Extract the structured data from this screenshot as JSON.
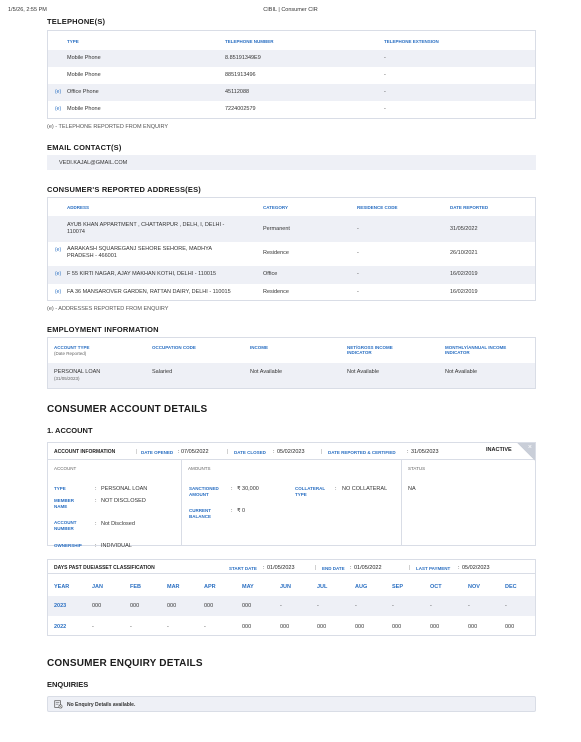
{
  "print_header": {
    "datetime": "1/5/26, 2:55 PM",
    "title": "CIBIL | Consumer CIR"
  },
  "telephones": {
    "title": "TELEPHONE(S)",
    "headers": [
      "TYPE",
      "TELEPHONE NUMBER",
      "TELEPHONE EXTENSION"
    ],
    "rows": [
      {
        "marker": "",
        "type": "Mobile Phone",
        "number": "8.85191349E9",
        "ext": "-"
      },
      {
        "marker": "",
        "type": "Mobile Phone",
        "number": "8851913496",
        "ext": "-"
      },
      {
        "marker": "(e)",
        "type": "Office Phone",
        "number": "45112088",
        "ext": "-"
      },
      {
        "marker": "(e)",
        "type": "Mobile Phone",
        "number": "7224002579",
        "ext": "-"
      }
    ],
    "footnote": "(e) - TELEPHONE REPORTED FROM ENQUIRY"
  },
  "emails": {
    "title": "EMAIL CONTACT(S)",
    "value": "VEDI.KAJAL@GMAIL.COM"
  },
  "addresses": {
    "title": "CONSUMER'S REPORTED ADDRESS(ES)",
    "headers": [
      "ADDRESS",
      "CATEGORY",
      "RESIDENCE CODE",
      "DATE REPORTED"
    ],
    "rows": [
      {
        "marker": "",
        "line1": "AYUB KHAN APPARTMENT , CHATTARPUR , DELH, I, DELHI -",
        "line2": "110074",
        "category": "Permanent",
        "code": "-",
        "date": "31/05/2022"
      },
      {
        "marker": "(e)",
        "line1": "AARAKASH SQUAREGANJ SEHORE SEHORE, MADHYA",
        "line2": "PRADESH - 466001",
        "category": "Residence",
        "code": "-",
        "date": "26/10/2021"
      },
      {
        "marker": "(e)",
        "line1": "F 55 KIRTI NAGAR, AJAY MAKHAN KOTHI, DELHI - 110015",
        "line2": "",
        "category": "Office",
        "code": "-",
        "date": "16/02/2019"
      },
      {
        "marker": "(e)",
        "line1": "FA 36 MANSAROVER GARDEN, RATTAN DAIRY, DELHI - 110015",
        "line2": "",
        "category": "Residence",
        "code": "-",
        "date": "16/02/2019"
      }
    ],
    "footnote": "(e) - ADDRESSES REPORTED FROM ENQUIRY"
  },
  "employment": {
    "title": "EMPLOYMENT INFORMATION",
    "headers": {
      "account_type": "ACCOUNT TYPE",
      "account_type_sub": "(Date Reported)",
      "occupation": "OCCUPATION CODE",
      "income": "INCOME",
      "net_gross_1": "NET/GROSS INCOME",
      "net_gross_2": "INDICATOR",
      "monthly_annual_1": "MONTHLY/ANNUAL INCOME",
      "monthly_annual_2": "INDICATOR"
    },
    "row": {
      "account_type": "PERSONAL LOAN",
      "date": "(31/05/2023)",
      "occupation": "Salaried",
      "income": "Not Available",
      "net_gross": "Not Available",
      "monthly_annual": "Not Available"
    }
  },
  "account_details": {
    "title": "CONSUMER ACCOUNT DETAILS",
    "subtitle": "1. ACCOUNT",
    "header": {
      "label": "ACCOUNT INFORMATION",
      "date_opened_label": "DATE OPENED",
      "date_opened": "07/05/2022",
      "date_closed_label": "DATE CLOSED",
      "date_closed": "05/02/2023",
      "date_reported_label": "DATE REPORTED & CERTIFIED",
      "date_reported": "31/05/2023",
      "status_badge": "INACTIVE",
      "close_glyph": "×"
    },
    "account": {
      "heading": "ACCOUNT",
      "type_label": "TYPE",
      "type": "PERSONAL LOAN",
      "member_label_1": "MEMBER",
      "member_label_2": "NAME",
      "member": "NOT DISCLOSED",
      "number_label_1": "ACCOUNT",
      "number_label_2": "NUMBER",
      "number": "Not Disclosed",
      "ownership_label": "OWNERSHIP",
      "ownership": "INDIVIDUAL"
    },
    "amounts": {
      "heading": "AMOUNTS",
      "sanctioned_label_1": "SANCTIONED",
      "sanctioned_label_2": "AMOUNT",
      "sanctioned": "₹ 30,000",
      "collateral_label_1": "COLLATERAL",
      "collateral_label_2": "TYPE",
      "collateral": "NO COLLATERAL",
      "current_label_1": "CURRENT",
      "current_label_2": "BALANCE",
      "current": "₹ 0"
    },
    "status": {
      "heading": "STATUS",
      "value": "NA"
    },
    "colon": ":",
    "dpd": {
      "label": "DAYS PAST DUE/ASSET CLASSIFICATION",
      "start_label": "START DATE",
      "start": "01/05/2023",
      "end_label": "END DATE",
      "end": "01/05/2022",
      "last_payment_label": "LAST PAYMENT",
      "last_payment": "05/02/2023",
      "months": [
        "YEAR",
        "JAN",
        "FEB",
        "MAR",
        "APR",
        "MAY",
        "JUN",
        "JUL",
        "AUG",
        "SEP",
        "OCT",
        "NOV",
        "DEC"
      ],
      "rows": [
        {
          "year": "2023",
          "values": [
            "000",
            "000",
            "000",
            "000",
            "000",
            "-",
            "-",
            "-",
            "-",
            "-",
            "-",
            "-"
          ]
        },
        {
          "year": "2022",
          "values": [
            "-",
            "-",
            "-",
            "-",
            "000",
            "000",
            "000",
            "000",
            "000",
            "000",
            "000",
            "000"
          ]
        }
      ]
    }
  },
  "enquiry": {
    "title": "CONSUMER ENQUIRY DETAILS",
    "subtitle": "ENQUIRIES",
    "message": "No Enquiry Details available."
  }
}
